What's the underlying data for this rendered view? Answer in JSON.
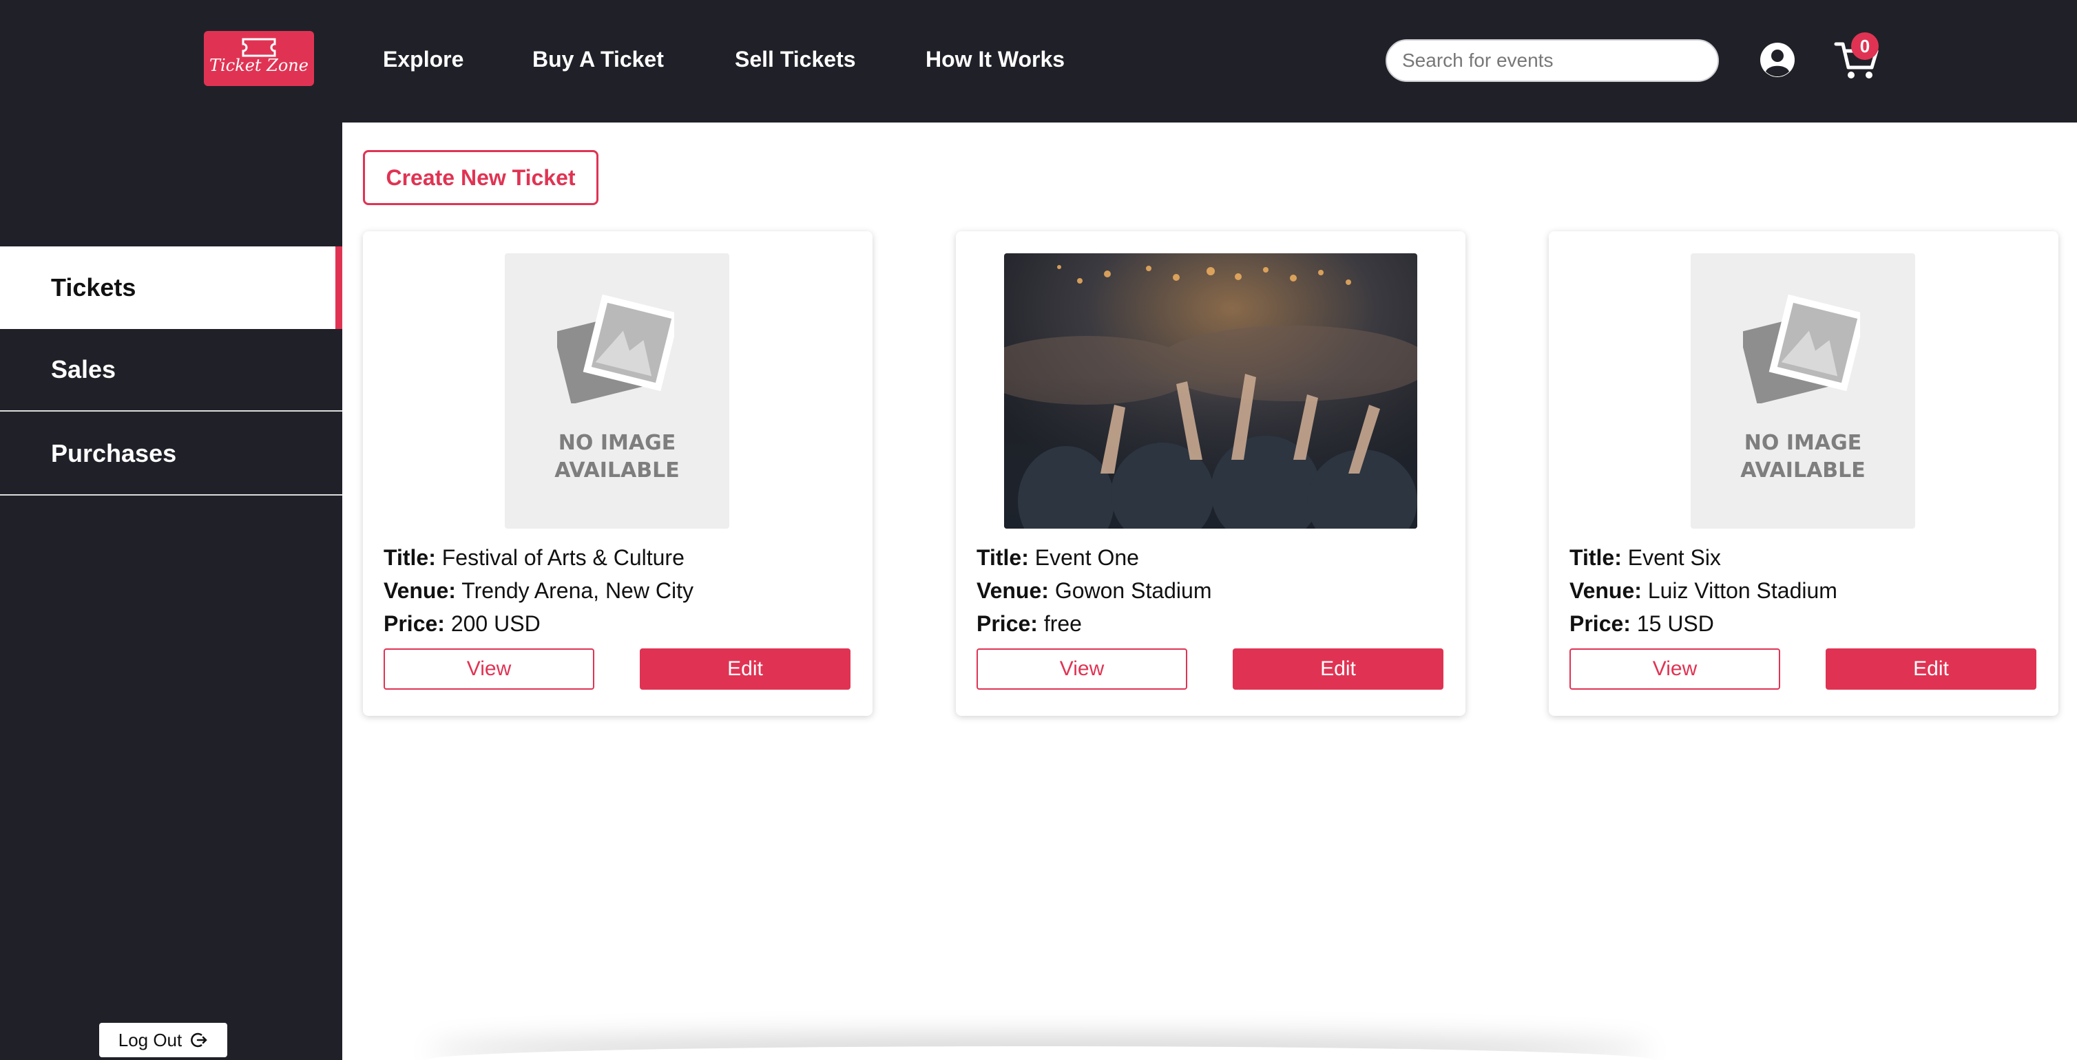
{
  "header": {
    "logo_text": "Ticket Zone",
    "nav": [
      "Explore",
      "Buy A Ticket",
      "Sell Tickets",
      "How It Works"
    ],
    "search_placeholder": "Search for events",
    "cart_count": "0",
    "icons": {
      "user": "user-circle-icon",
      "cart": "shopping-cart-icon",
      "logo": "ticket-icon"
    }
  },
  "sidebar": {
    "items": [
      {
        "label": "Tickets",
        "active": true
      },
      {
        "label": "Sales",
        "active": false
      },
      {
        "label": "Purchases",
        "active": false
      }
    ],
    "logout_label": "Log Out",
    "logout_icon": "logout-icon"
  },
  "main": {
    "create_label": "Create New Ticket",
    "field_labels": {
      "title": "Title:",
      "venue": "Venue:",
      "price": "Price:"
    },
    "view_label": "View",
    "edit_label": "Edit",
    "placeholder_text": "NO IMAGE AVAILABLE",
    "cards": [
      {
        "title": "Festival of Arts & Culture",
        "venue": "Trendy Arena, New City",
        "price": "200 USD",
        "image": "placeholder"
      },
      {
        "title": "Event One",
        "venue": "Gowon Stadium",
        "price": "free",
        "image": "concert-crowd-photo"
      },
      {
        "title": "Event Six",
        "venue": "Luiz Vitton Stadium",
        "price": "15 USD",
        "image": "placeholder"
      }
    ]
  },
  "colors": {
    "accent": "#e03353",
    "dark": "#202128",
    "white": "#ffffff"
  }
}
